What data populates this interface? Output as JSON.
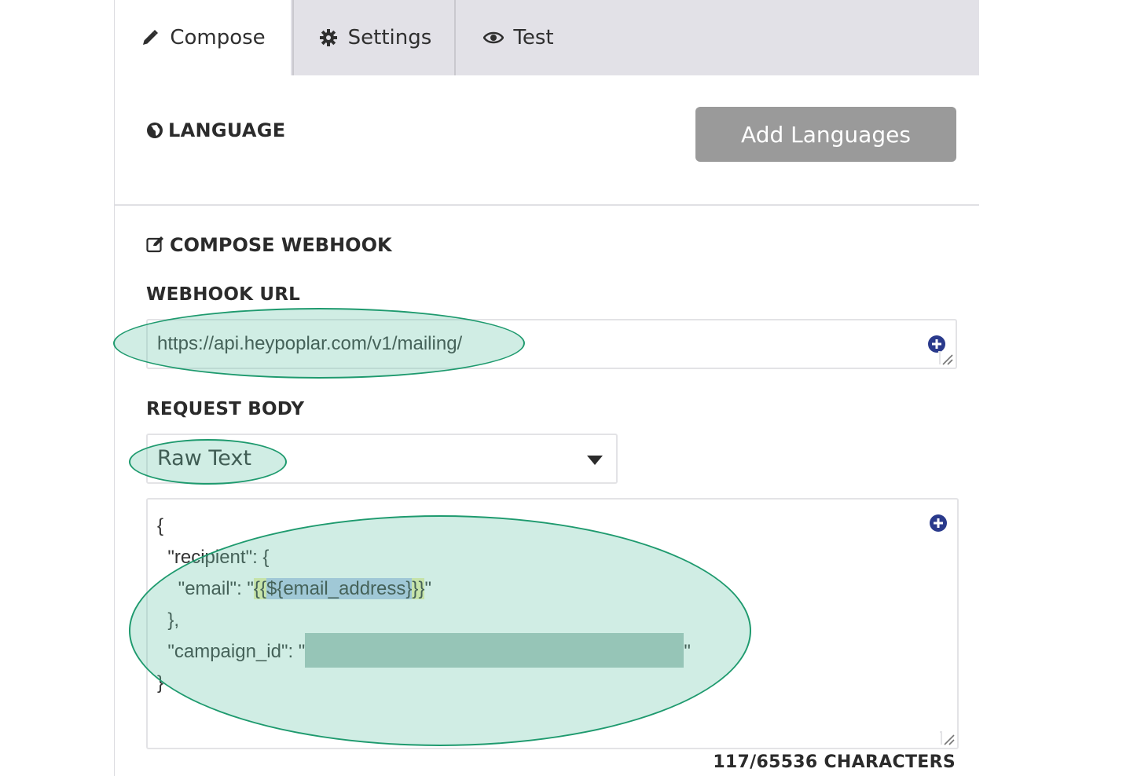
{
  "tabs": {
    "compose": "Compose",
    "settings": "Settings",
    "test": "Test"
  },
  "language": {
    "heading": "LANGUAGE",
    "add_button": "Add Languages"
  },
  "compose": {
    "heading": "COMPOSE WEBHOOK",
    "url_label": "WEBHOOK URL",
    "url_value": "https://api.heypoplar.com/v1/mailing/",
    "body_label": "REQUEST BODY",
    "body_type": "Raw Text",
    "code": {
      "l1": "{",
      "l2": "  \"recipient\": {",
      "l3_pre": "    \"email\": \"",
      "l3_y1": "{{",
      "l3_var": "${email_address}",
      "l3_y2": "}}",
      "l3_post": "\"",
      "l4": "  },",
      "l5_pre": "  \"campaign_id\": \"",
      "l5_post": "\"",
      "l6": "}"
    },
    "char_count": "117/65536 CHARACTERS"
  },
  "colors": {
    "tab_bar": "#e2e1e7",
    "button_gray": "#9a9a9a",
    "plus_icon": "#2a3a8c",
    "annotation": "#1e9a6e"
  }
}
